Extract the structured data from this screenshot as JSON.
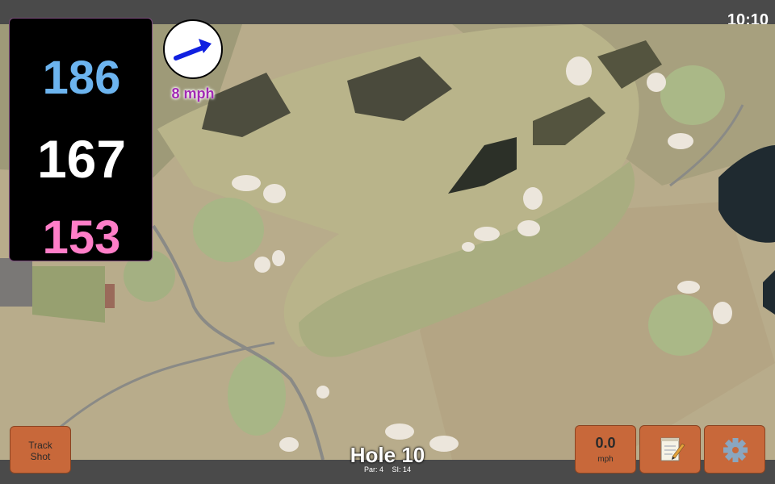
{
  "status": {
    "time": "10:10"
  },
  "distances": {
    "back": "186",
    "middle": "167",
    "front": "153"
  },
  "wind": {
    "speed_label": "8 mph",
    "direction_icon": "wind-arrow-icon"
  },
  "hole": {
    "title": "Hole 10",
    "par_label": "Par: 4",
    "si_label": "SI: 14"
  },
  "buttons": {
    "track_shot_line1": "Track",
    "track_shot_line2": "Shot",
    "speed_value": "0.0",
    "speed_unit": "mph",
    "notes_icon": "notepad-icon",
    "settings_icon": "gear-icon"
  },
  "colors": {
    "back_distance": "#6cb4ef",
    "middle_distance": "#ffffff",
    "front_distance": "#ff7ec8",
    "button": "#c8683a",
    "wind_label": "#a22ab4"
  }
}
